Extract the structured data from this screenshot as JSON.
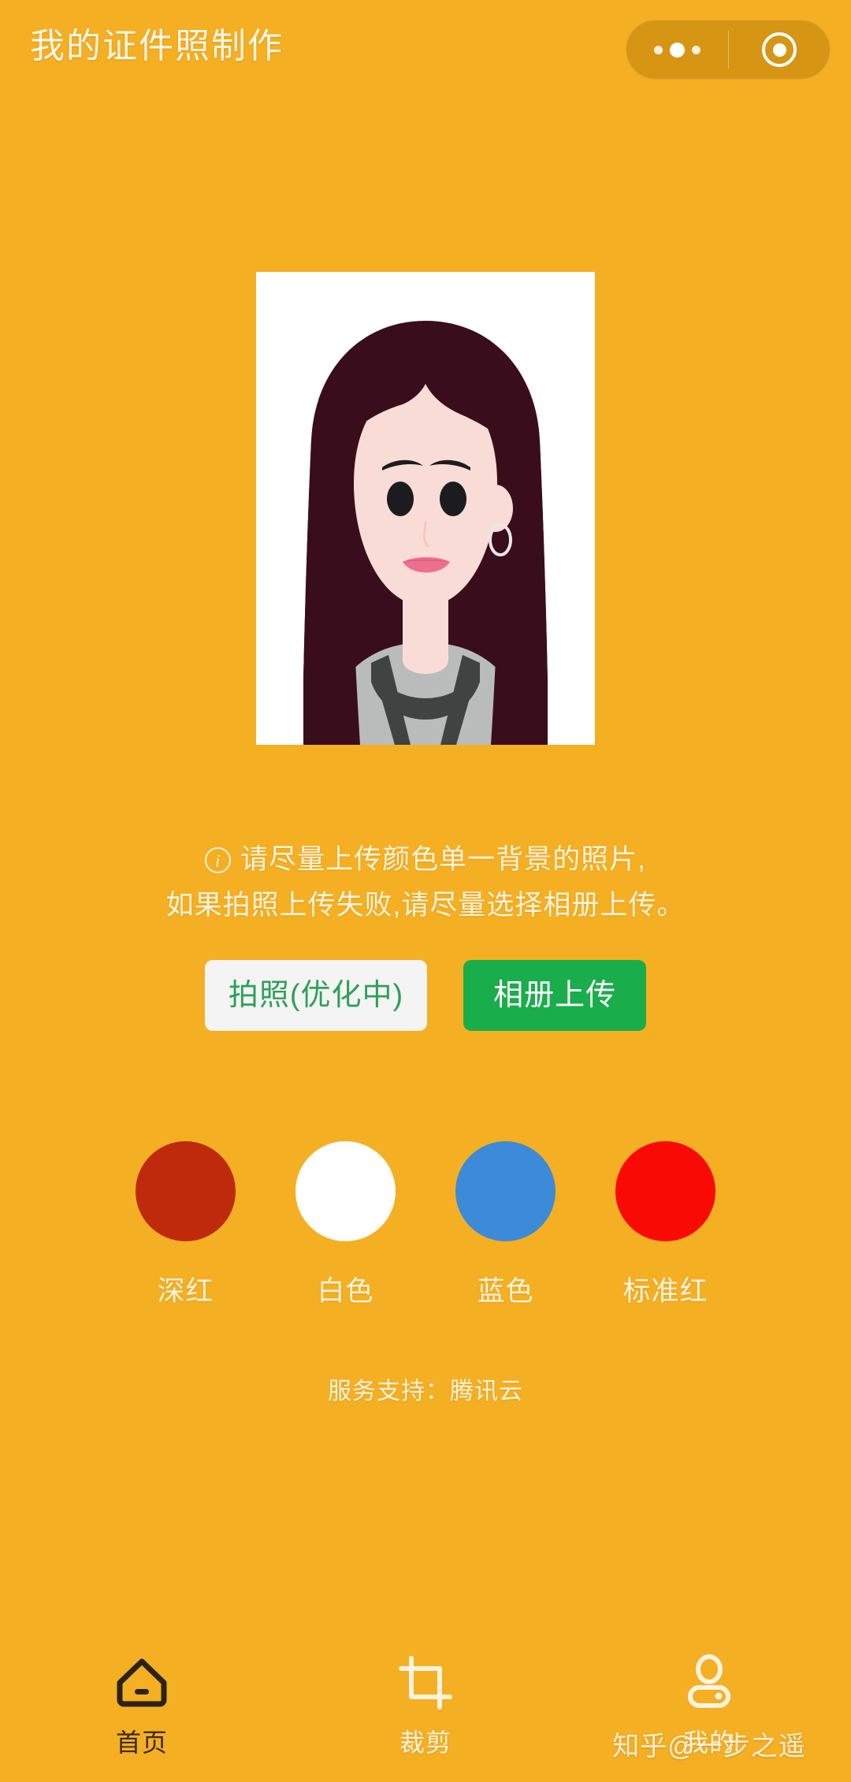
{
  "theme": {
    "background": "#f5af22",
    "text_light": "#fdf3df",
    "brand_green": "#1aad4b",
    "tab_active": "#3a2a12"
  },
  "header": {
    "title": "我的证件照制作",
    "capsule": {
      "menu_icon": "more-dots-icon",
      "target_icon": "target-circle-icon"
    }
  },
  "preview": {
    "alt": "证件照预览",
    "background": "#ffffff",
    "colors": {
      "hair": "#3a0d1c",
      "skin": "#fadcd6",
      "eye": "#1c1c20",
      "lips": "#ef6d8e",
      "shirt": "#b9bcbb",
      "strap": "#3f4341",
      "earring": "#e8e8e8"
    }
  },
  "tips": {
    "info_icon": "info-circle-icon",
    "line1": "请尽量上传颜色单一背景的照片,",
    "line2": "如果拍照上传失败,请尽量选择相册上传。"
  },
  "actions": {
    "camera_label": "拍照(优化中)",
    "album_label": "相册上传"
  },
  "swatches": [
    {
      "name": "深红",
      "color": "#bf2a0c"
    },
    {
      "name": "白色",
      "color": "#ffffff"
    },
    {
      "name": "蓝色",
      "color": "#3d8ad8"
    },
    {
      "name": "标准红",
      "color": "#fa0a04"
    }
  ],
  "service": {
    "text": "服务支持：腾讯云"
  },
  "tabbar": {
    "items": [
      {
        "label": "首页",
        "icon": "home-icon",
        "active": true
      },
      {
        "label": "裁剪",
        "icon": "crop-icon",
        "active": false
      },
      {
        "label": "我的",
        "icon": "user-profile-icon",
        "active": false
      }
    ]
  },
  "watermark": {
    "text": "知乎@一步之遥"
  }
}
